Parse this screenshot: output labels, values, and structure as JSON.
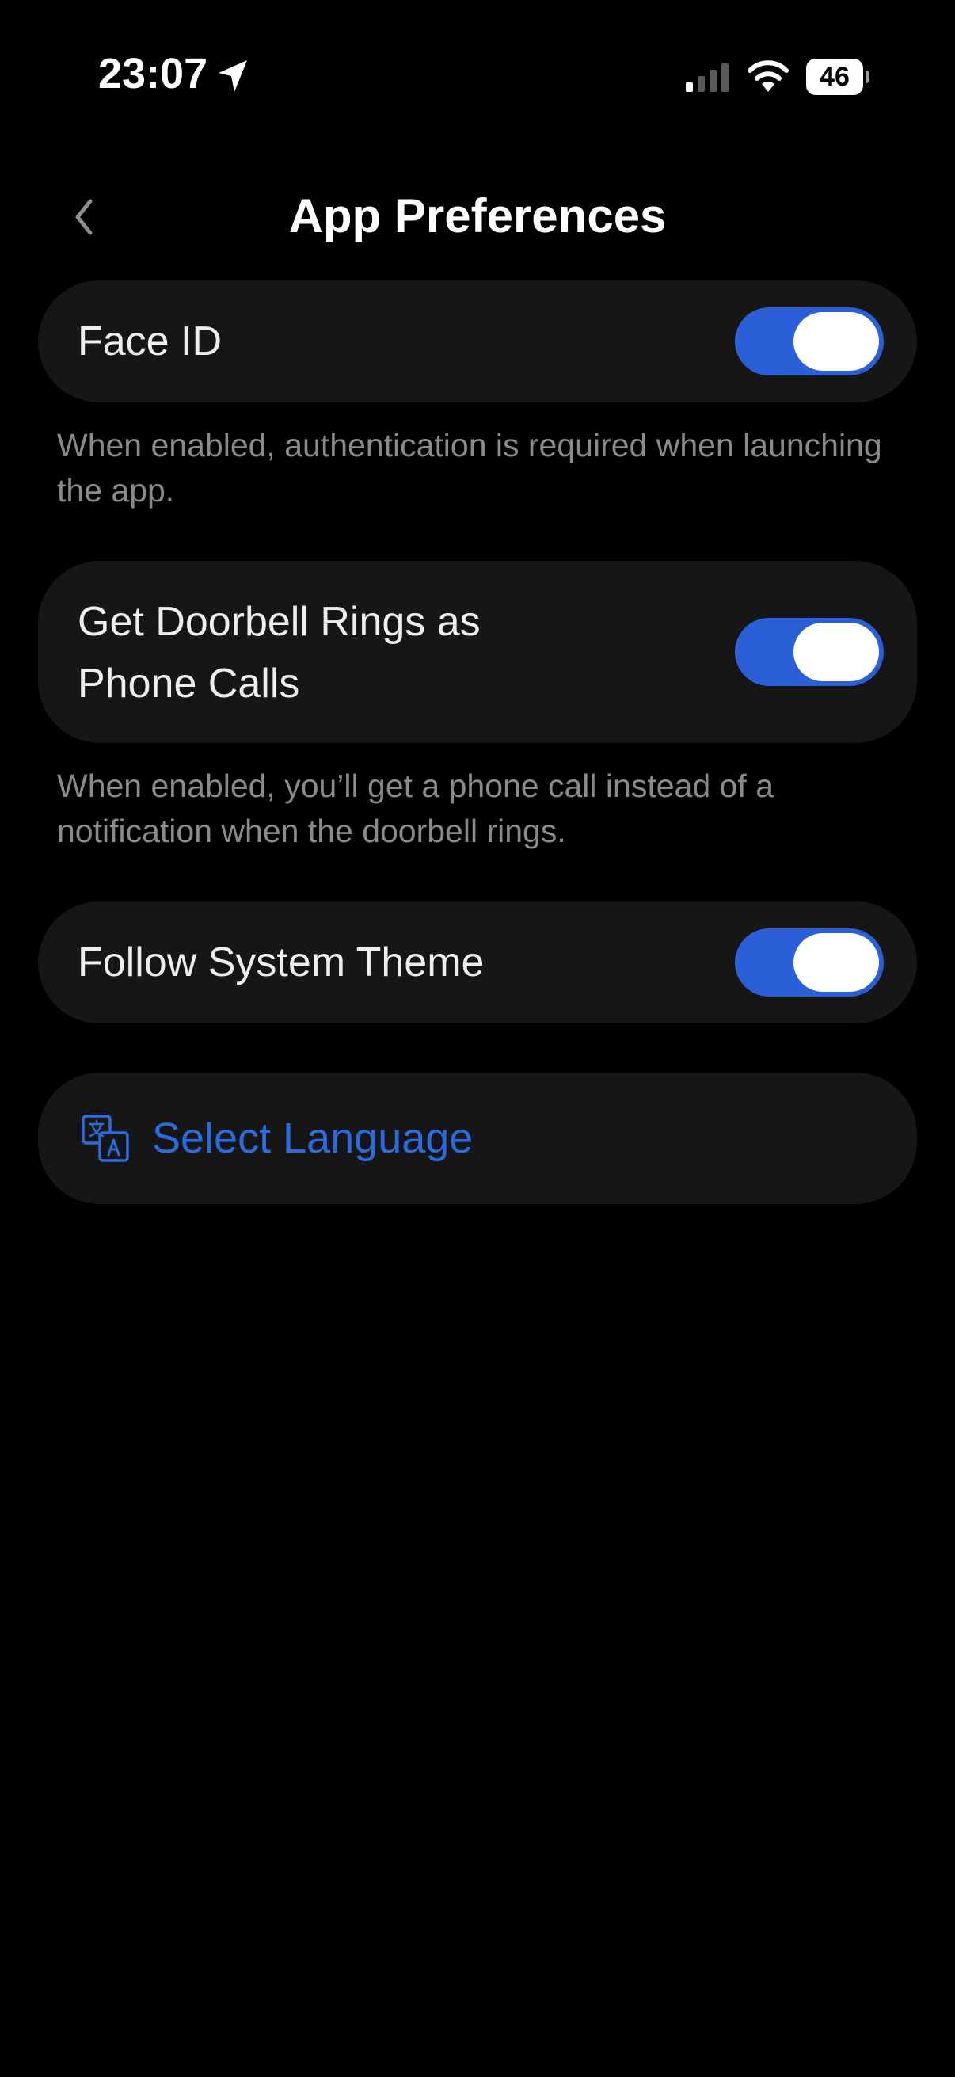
{
  "status_bar": {
    "time": "23:07",
    "battery": "46",
    "icons": [
      "location-arrow-icon",
      "cellular-signal-icon",
      "wifi-icon",
      "battery-icon"
    ]
  },
  "header": {
    "title": "App Preferences",
    "back_icon": "chevron-left-icon"
  },
  "settings": {
    "face_id": {
      "label": "Face ID",
      "enabled": true,
      "hint": "When enabled, authentication is required when launching the app."
    },
    "doorbell_calls": {
      "label": "Get Doorbell Rings as Phone Calls",
      "enabled": true,
      "hint": "When enabled, you’ll get a phone call instead of a notification when the doorbell rings."
    },
    "system_theme": {
      "label": "Follow System Theme",
      "enabled": true
    },
    "language": {
      "label": "Select Language",
      "icon": "translate-icon"
    }
  },
  "colors": {
    "background": "#000000",
    "card": "#161616",
    "accent": "#2b5fd8",
    "link": "#2b6be0",
    "hint_text": "#8a8a8e"
  }
}
